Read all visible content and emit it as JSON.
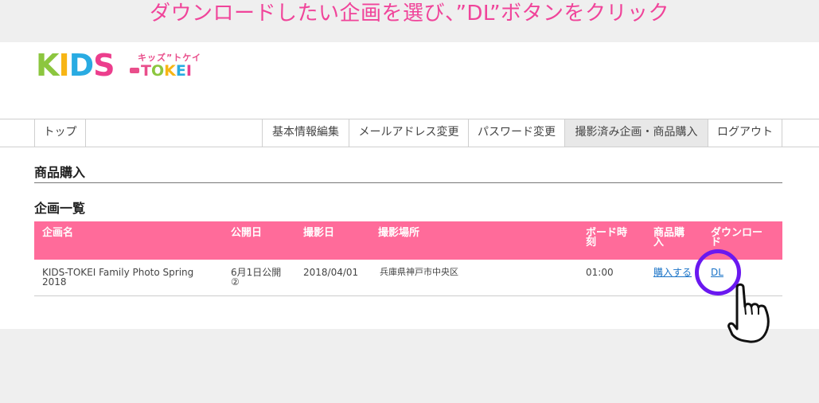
{
  "banner": {
    "text": "ダウンロードしたい企画を選び、”DL”ボタンをクリック"
  },
  "logo": {
    "letters": [
      "K",
      "I",
      "D",
      "S"
    ],
    "kana": "キッズ”トケイ",
    "tokei": [
      "T",
      "O",
      "K",
      "E",
      "I"
    ]
  },
  "nav": {
    "items": [
      {
        "label": "トップ"
      },
      {
        "label": "基本情報編集"
      },
      {
        "label": "メールアドレス変更"
      },
      {
        "label": "パスワード変更"
      },
      {
        "label": "撮影済み企画・商品購入"
      },
      {
        "label": "ログアウト"
      }
    ],
    "active_index": 4
  },
  "section_title": "商品購入",
  "list_title": "企画一覧",
  "table": {
    "headers": {
      "name": "企画名",
      "publish": "公開日",
      "shoot": "撮影日",
      "location": "撮影場所",
      "board_line1": "ボード時",
      "board_line2": "刻",
      "buy_line1": "商品購",
      "buy_line2": "入",
      "download_line1": "ダウンロー",
      "download_line2": "ド"
    },
    "rows": [
      {
        "name_line1": "KIDS-TOKEI Family Photo Spring",
        "name_line2": "2018",
        "publish_line1": "6月1日公開",
        "publish_line2": "②",
        "shoot": "2018/04/01",
        "location": "兵庫県神戸市中央区",
        "board_time": "01:00",
        "buy_link": "購入する",
        "download_link": "DL"
      }
    ]
  },
  "annotation": {
    "circle_color": "#6a18f0",
    "hand": "pointing-hand-icon"
  },
  "colors": {
    "banner_text": "#f0449a",
    "table_header": "#ff6b9a",
    "link": "#1a73c7"
  }
}
